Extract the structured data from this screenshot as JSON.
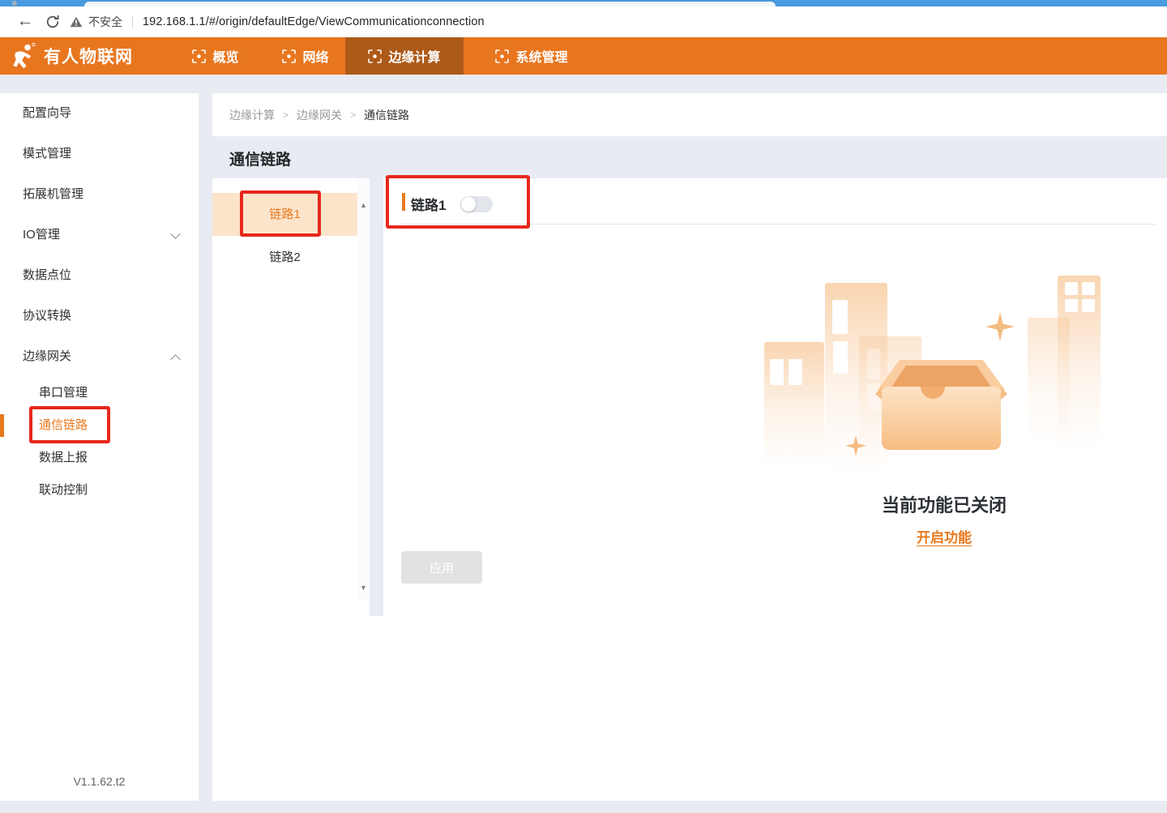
{
  "browser": {
    "security_label": "不安全",
    "url": "192.168.1.1/#/origin/defaultEdge/ViewCommunicationconnection"
  },
  "header": {
    "brand": "有人物联网",
    "nav": [
      {
        "label": "概览",
        "active": false
      },
      {
        "label": "网络",
        "active": false
      },
      {
        "label": "边缘计算",
        "active": true
      },
      {
        "label": "系统管理",
        "active": false
      }
    ]
  },
  "sidebar": {
    "items": [
      {
        "label": "配置向导"
      },
      {
        "label": "模式管理"
      },
      {
        "label": "拓展机管理"
      },
      {
        "label": "IO管理",
        "expandable": true,
        "expanded": false
      },
      {
        "label": "数据点位"
      },
      {
        "label": "协议转换"
      },
      {
        "label": "边缘网关",
        "expandable": true,
        "expanded": true,
        "children": [
          {
            "label": "串口管理",
            "active": false
          },
          {
            "label": "通信链路",
            "active": true
          },
          {
            "label": "数据上报",
            "active": false
          },
          {
            "label": "联动控制",
            "active": false
          }
        ]
      }
    ],
    "version": "V1.1.62.t2"
  },
  "breadcrumb": {
    "items": [
      "边缘计算",
      "边缘网关",
      "通信链路"
    ],
    "separator": ">"
  },
  "page": {
    "title": "通信链路"
  },
  "link_list": [
    {
      "label": "链路1",
      "active": true
    },
    {
      "label": "链路2",
      "active": false
    }
  ],
  "panel": {
    "section_title": "链路1",
    "toggle_on": false,
    "empty_title": "当前功能已关闭",
    "enable_link_label": "开启功能",
    "apply_label": "应用"
  },
  "icons": {
    "back_arrow": "←",
    "scroll_up": "▲",
    "scroll_down": "▼"
  },
  "colors": {
    "primary_orange": "#e8761f",
    "nav_active_bg": "#ad5a19",
    "accent_text": "#e8791e",
    "highlight_peach": "#fce4cb",
    "annotation_red": "#e6281c"
  }
}
